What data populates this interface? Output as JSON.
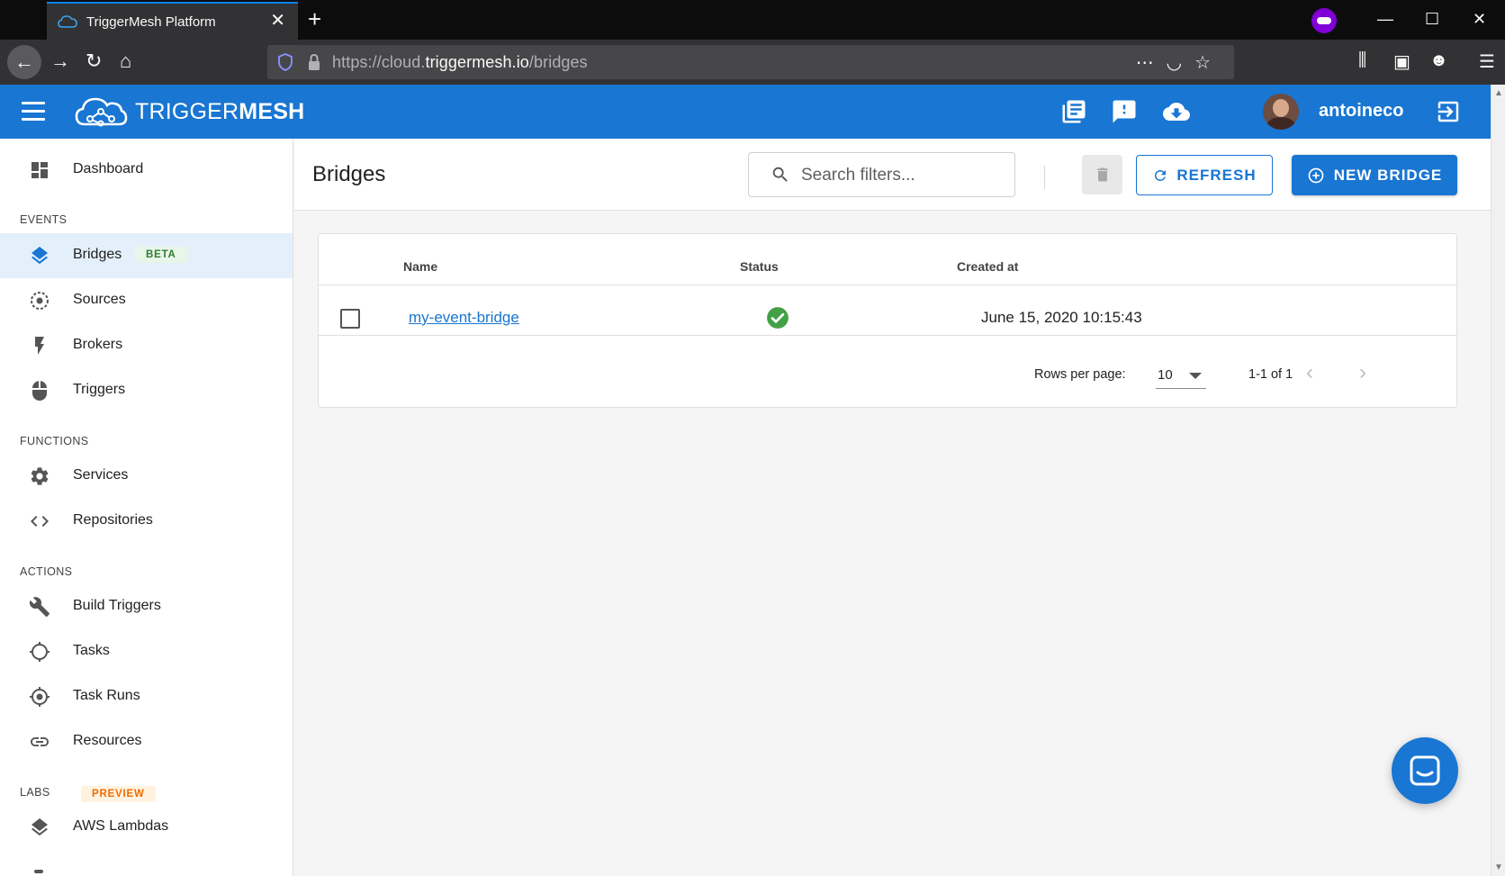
{
  "browser": {
    "tab_title": "TriggerMesh Platform",
    "url_prefix": "https://cloud.",
    "url_host": "triggermesh.io",
    "url_path": "/bridges"
  },
  "app": {
    "logo_light": "TRIGGER",
    "logo_bold": "MESH",
    "username": "antoineco",
    "accent_color": "#1976d2"
  },
  "sidebar": {
    "dashboard": "Dashboard",
    "sections": {
      "events": "EVENTS",
      "functions": "FUNCTIONS",
      "actions": "ACTIONS",
      "labs": "LABS"
    },
    "badges": {
      "beta": "BETA",
      "preview": "PREVIEW"
    },
    "items": {
      "bridges": "Bridges",
      "sources": "Sources",
      "brokers": "Brokers",
      "triggers": "Triggers",
      "services": "Services",
      "repositories": "Repositories",
      "build_triggers": "Build Triggers",
      "tasks": "Tasks",
      "task_runs": "Task Runs",
      "resources": "Resources",
      "aws_lambdas": "AWS Lambdas"
    }
  },
  "page": {
    "title": "Bridges",
    "search_placeholder": "Search filters...",
    "refresh_label": "REFRESH",
    "new_bridge_label": "NEW BRIDGE"
  },
  "table": {
    "columns": {
      "name": "Name",
      "status": "Status",
      "created": "Created at"
    },
    "rows": [
      {
        "name": "my-event-bridge",
        "status": "ok",
        "created": "June 15, 2020 10:15:43"
      }
    ],
    "rows_per_page_label": "Rows per page:",
    "rows_per_page": "10",
    "range": "1-1 of 1"
  }
}
